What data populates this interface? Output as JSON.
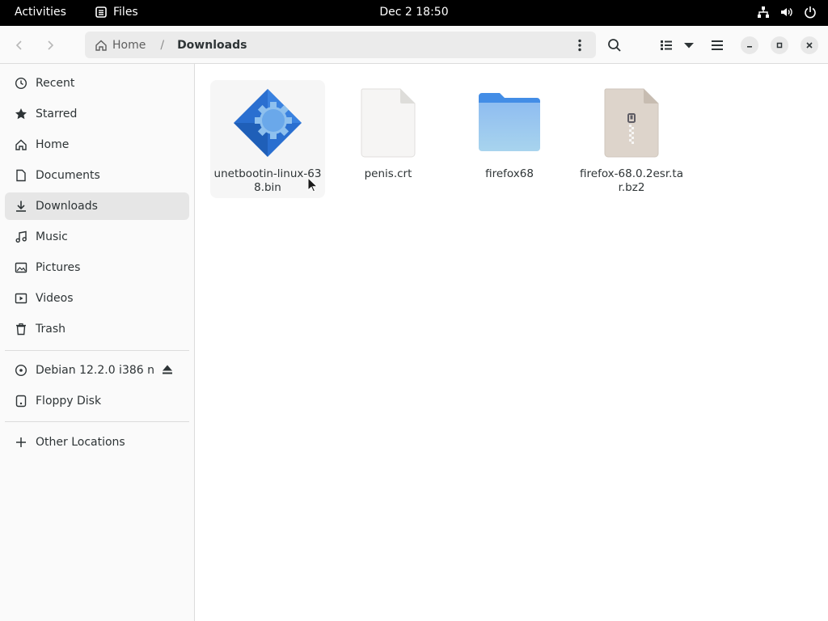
{
  "topbar": {
    "activities": "Activities",
    "app_name": "Files",
    "clock": "Dec 2  18:50"
  },
  "header": {
    "path_home": "Home",
    "path_separator": "/",
    "path_current": "Downloads"
  },
  "sidebar": {
    "items": [
      {
        "label": "Recent",
        "icon": "clock-icon"
      },
      {
        "label": "Starred",
        "icon": "star-icon"
      },
      {
        "label": "Home",
        "icon": "home-icon"
      },
      {
        "label": "Documents",
        "icon": "document-icon"
      },
      {
        "label": "Downloads",
        "icon": "download-icon",
        "active": true
      },
      {
        "label": "Music",
        "icon": "music-icon"
      },
      {
        "label": "Pictures",
        "icon": "picture-icon"
      },
      {
        "label": "Videos",
        "icon": "video-icon"
      },
      {
        "label": "Trash",
        "icon": "trash-icon"
      }
    ],
    "devices": [
      {
        "label": "Debian 12.2.0 i386 n",
        "icon": "disc-icon"
      },
      {
        "label": "Floppy Disk",
        "icon": "drive-icon"
      }
    ],
    "other": {
      "label": "Other Locations",
      "icon": "plus-icon"
    }
  },
  "files": [
    {
      "name": "unetbootin-linux-638.bin",
      "icon": "executable-icon"
    },
    {
      "name": "penis.crt",
      "icon": "blank-file-icon"
    },
    {
      "name": "firefox68",
      "icon": "folder-icon"
    },
    {
      "name": "firefox-68.0.2esr.tar.bz2",
      "icon": "archive-icon"
    }
  ],
  "colors": {
    "folder": "#5e9de6",
    "accent": "#3584e4",
    "archive": "#d9d0c7"
  }
}
